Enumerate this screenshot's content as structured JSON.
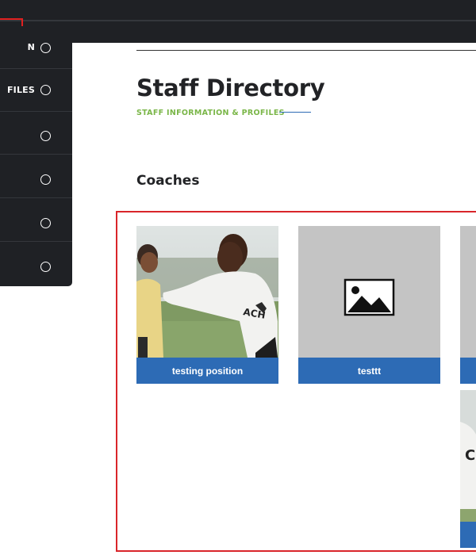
{
  "sidebar": {
    "items": [
      {
        "label": "N"
      },
      {
        "label": "FILES"
      },
      {
        "label": ""
      },
      {
        "label": ""
      },
      {
        "label": ""
      },
      {
        "label": ""
      }
    ]
  },
  "page": {
    "title": "Staff Directory",
    "subtitle": "STAFF INFORMATION & PROFILES",
    "section_heading": "Coaches"
  },
  "cards": [
    {
      "name": "testing position",
      "image": "photo"
    },
    {
      "name": "testtt",
      "image": "image-placeholder-icon"
    },
    {
      "name": "",
      "image": "placeholder"
    },
    {
      "name": "",
      "image": "photo"
    }
  ],
  "colors": {
    "dark_bg": "#1f2125",
    "accent_blue": "#2d6bb5",
    "accent_green": "#7ab648",
    "highlight_red": "#d9252a",
    "placeholder_gray": "#c4c4c4"
  }
}
